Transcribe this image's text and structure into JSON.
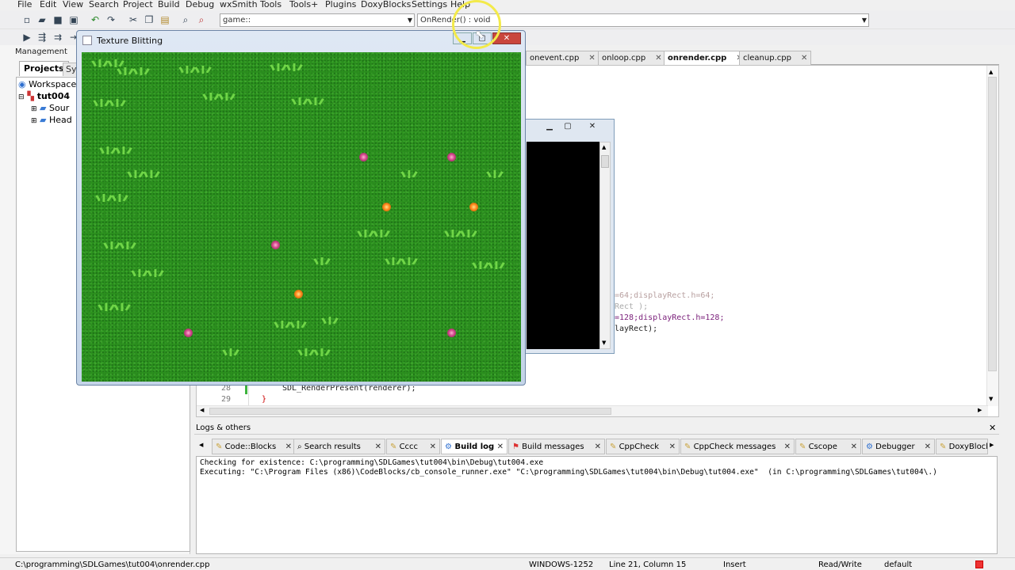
{
  "menubar": {
    "items": [
      "File",
      "Edit",
      "View",
      "Search",
      "Project",
      "Build",
      "Debug",
      "wxSmith",
      "Tools",
      "Tools+",
      "Plugins",
      "DoxyBlocks",
      "Settings",
      "Help"
    ]
  },
  "toolbar": {
    "scope_combo": "game::",
    "function_combo": "OnRender() : void"
  },
  "management": {
    "title": "Management",
    "tab_projects": "Projects",
    "tab_symbols": "Sy",
    "tree": {
      "workspace": "Workspace",
      "project": "tut004",
      "sources": "Sour",
      "headers": "Head"
    }
  },
  "editor": {
    "tabs": [
      {
        "label": "onevent.cpp",
        "active": false
      },
      {
        "label": "onloop.cpp",
        "active": false
      },
      {
        "label": "onrender.cpp",
        "active": true
      },
      {
        "label": "cleanup.cpp",
        "active": false
      }
    ],
    "code": {
      "line_a": "=64;displayRect.h=64;",
      "line_b": "Rect );",
      "line_c": "=128;displayRect.h=128;",
      "line_d": "layRect);",
      "num_28": "28",
      "code_28": "SDL_RenderPresent(renderer);",
      "num_29": "29",
      "code_29": "}"
    }
  },
  "logs": {
    "title": "Logs & others",
    "tabs": [
      "Code::Blocks",
      "Search results",
      "Cccc",
      "Build log",
      "Build messages",
      "CppCheck",
      "CppCheck messages",
      "Cscope",
      "Debugger",
      "DoxyBlock"
    ],
    "active_tab": "Build log",
    "lines": [
      "Checking for existence: C:\\programming\\SDLGames\\tut004\\bin\\Debug\\tut004.exe",
      "Executing: \"C:\\Program Files (x86)\\CodeBlocks/cb_console_runner.exe\" \"C:\\programming\\SDLGames\\tut004\\bin\\Debug\\tut004.exe\"  (in C:\\programming\\SDLGames\\tut004\\.)"
    ]
  },
  "game_window": {
    "title": "Texture Blitting"
  },
  "statusbar": {
    "path": "C:\\programming\\SDLGames\\tut004\\onrender.cpp",
    "encoding": "WINDOWS-1252",
    "position": "Line 21, Column 15",
    "mode": "Insert",
    "access": "Read/Write",
    "lang": "default"
  },
  "colors": {
    "grass": "#2b8f1e",
    "flower_pink": "#d2488c",
    "flower_orange": "#ff8a1e",
    "cursor_highlight": "#f3ea4a"
  }
}
